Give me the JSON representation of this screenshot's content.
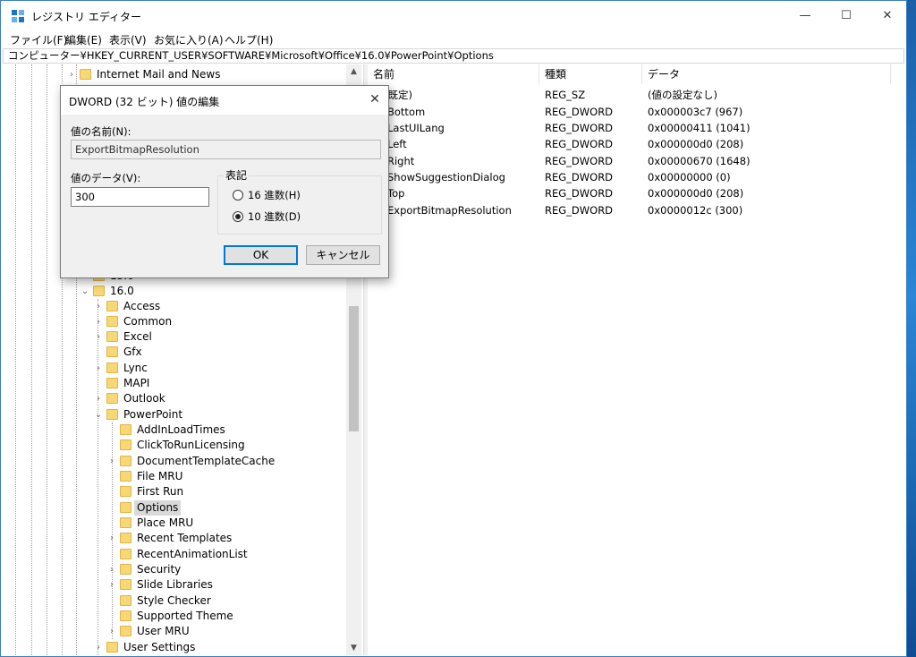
{
  "window": {
    "title": "レジストリ エディター",
    "controls": {
      "minimize": "—",
      "maximize": "☐",
      "close": "✕"
    }
  },
  "menu": [
    "ファイル(F)",
    "編集(E)",
    "表示(V)",
    "お気に入り(A)",
    "ヘルプ(H)"
  ],
  "address": "コンピューター¥HKEY_CURRENT_USER¥SOFTWARE¥Microsoft¥Office¥16.0¥PowerPoint¥Options",
  "tree": {
    "top_item": "Internet Mail and News",
    "partial_item": "15.0",
    "version_key": "16.0",
    "version_children": [
      "Access",
      "Common",
      "Excel",
      "Gfx",
      "Lync",
      "MAPI",
      "Outlook",
      "PowerPoint"
    ],
    "powerpoint_children": [
      "AddInLoadTimes",
      "ClickToRunLicensing",
      "DocumentTemplateCache",
      "File MRU",
      "First Run",
      "Options",
      "Place MRU",
      "Recent Templates",
      "RecentAnimationList",
      "Security",
      "Slide Libraries",
      "Style Checker",
      "Supported Theme",
      "User MRU"
    ],
    "bottom_item": "User Settings",
    "selected": "Options"
  },
  "list": {
    "columns": [
      "名前",
      "種類",
      "データ"
    ],
    "rows": [
      {
        "name": "(既定)",
        "type": "REG_SZ",
        "data": "(値の設定なし)"
      },
      {
        "name": "Bottom",
        "type": "REG_DWORD",
        "data": "0x000003c7 (967)"
      },
      {
        "name": "LastUILang",
        "type": "REG_DWORD",
        "data": "0x00000411 (1041)"
      },
      {
        "name": "Left",
        "type": "REG_DWORD",
        "data": "0x000000d0 (208)"
      },
      {
        "name": "Right",
        "type": "REG_DWORD",
        "data": "0x00000670 (1648)"
      },
      {
        "name": "ShowSuggestionDialog",
        "type": "REG_DWORD",
        "data": "0x00000000 (0)"
      },
      {
        "name": "Top",
        "type": "REG_DWORD",
        "data": "0x000000d0 (208)"
      },
      {
        "name": "ExportBitmapResolution",
        "type": "REG_DWORD",
        "data": "0x0000012c (300)"
      }
    ]
  },
  "dialog": {
    "title": "DWORD (32 ビット) 値の編集",
    "value_name_label": "値の名前(N):",
    "value_name": "ExportBitmapResolution",
    "value_data_label": "値のデータ(V):",
    "value_data": "300",
    "base_group_label": "表記",
    "hex_label": "16 進数(H)",
    "dec_label": "10 進数(D)",
    "selected_base": "10 進数(D)",
    "ok_label": "OK",
    "cancel_label": "キャンセル"
  },
  "colors": {
    "accent": "#0078d7",
    "folder": "#f8d775",
    "desktop": "#1e6fb8"
  }
}
